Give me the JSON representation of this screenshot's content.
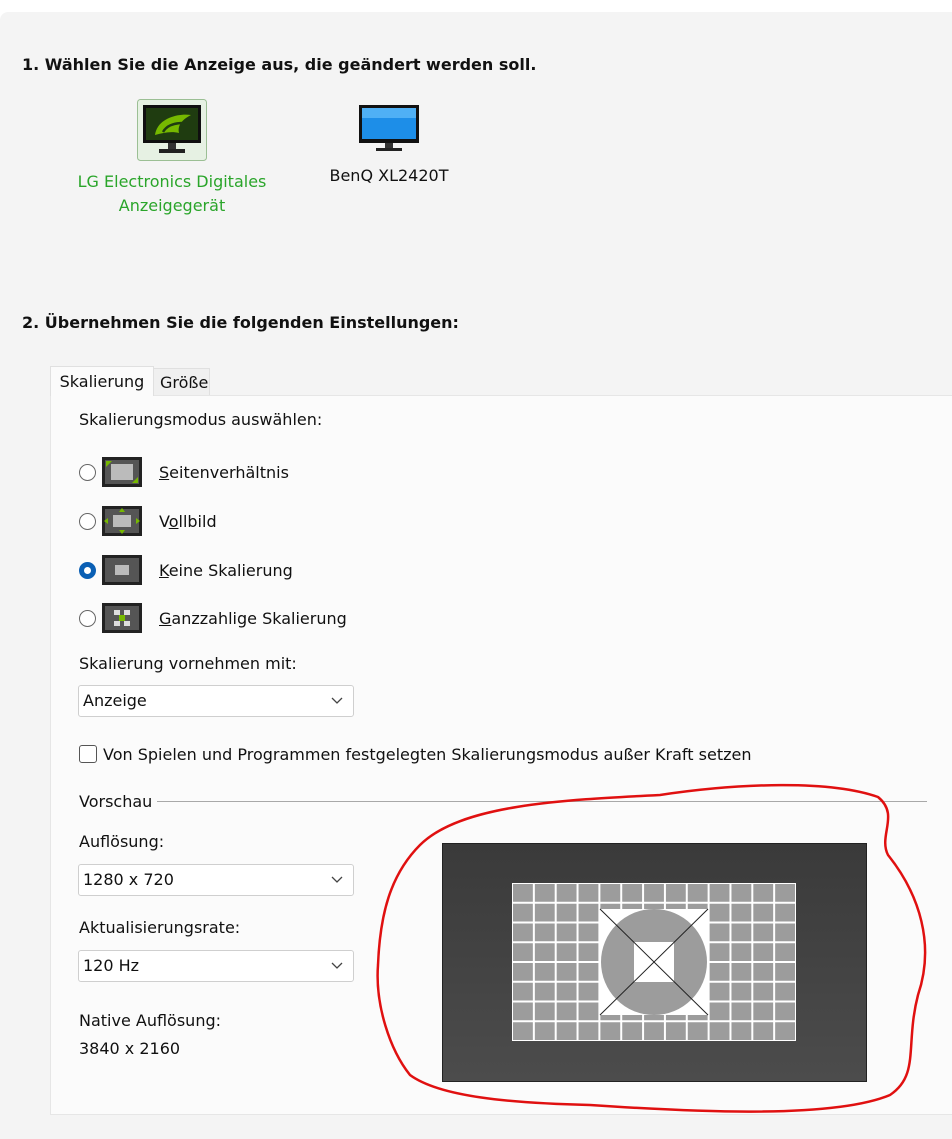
{
  "step1": {
    "heading": "1. Wählen Sie die Anzeige aus, die geändert werden soll.",
    "displays": [
      {
        "name": "LG Electronics Digitales Anzeigegerät",
        "line1": "LG Electronics Digitales",
        "line2": "Anzeigegerät",
        "selected": true
      },
      {
        "name": "BenQ XL2420T",
        "selected": false
      }
    ]
  },
  "step2": {
    "heading": "2. Übernehmen Sie die folgenden Einstellungen:",
    "tabs": [
      {
        "label": "Skalierung",
        "active": true
      },
      {
        "label": "Größe",
        "active": false
      }
    ],
    "mode_label": "Skalierungsmodus auswählen:",
    "modes": [
      {
        "first": "S",
        "rest": "eitenverhältnis",
        "label": "Seitenverhältnis",
        "selected": false
      },
      {
        "first": "V",
        "rest_pre": "",
        "under": "o",
        "rest": "llbild",
        "label": "Vollbild",
        "selected": false
      },
      {
        "first": "K",
        "rest": "eine Skalierung",
        "label": "Keine Skalierung",
        "selected": true
      },
      {
        "first": "G",
        "rest": "anzzahlige Skalierung",
        "label": "Ganzzahlige Skalierung",
        "selected": false
      }
    ],
    "perform_label": "Skalierung vornehmen mit:",
    "perform_value": "Anzeige",
    "override_label": "Von Spielen und Programmen festgelegten Skalierungsmodus außer Kraft setzen",
    "override_checked": false,
    "preview_label": "Vorschau",
    "resolution_label": "Auflösung:",
    "resolution_value": "1280 x 720",
    "refresh_label": "Aktualisierungsrate:",
    "refresh_value": "120 Hz",
    "native_label": "Native Auflösung:",
    "native_value": "3840 x 2160"
  },
  "colors": {
    "accent_green": "#2aa52a",
    "radio_selected": "#0a5fb4",
    "annotation": "#e01010",
    "icon_green": "#76b900"
  },
  "icons": {
    "lg_display": "monitor-nvidia-icon",
    "benq_display": "monitor-blue-icon",
    "chevron": "chevron-down-icon"
  }
}
